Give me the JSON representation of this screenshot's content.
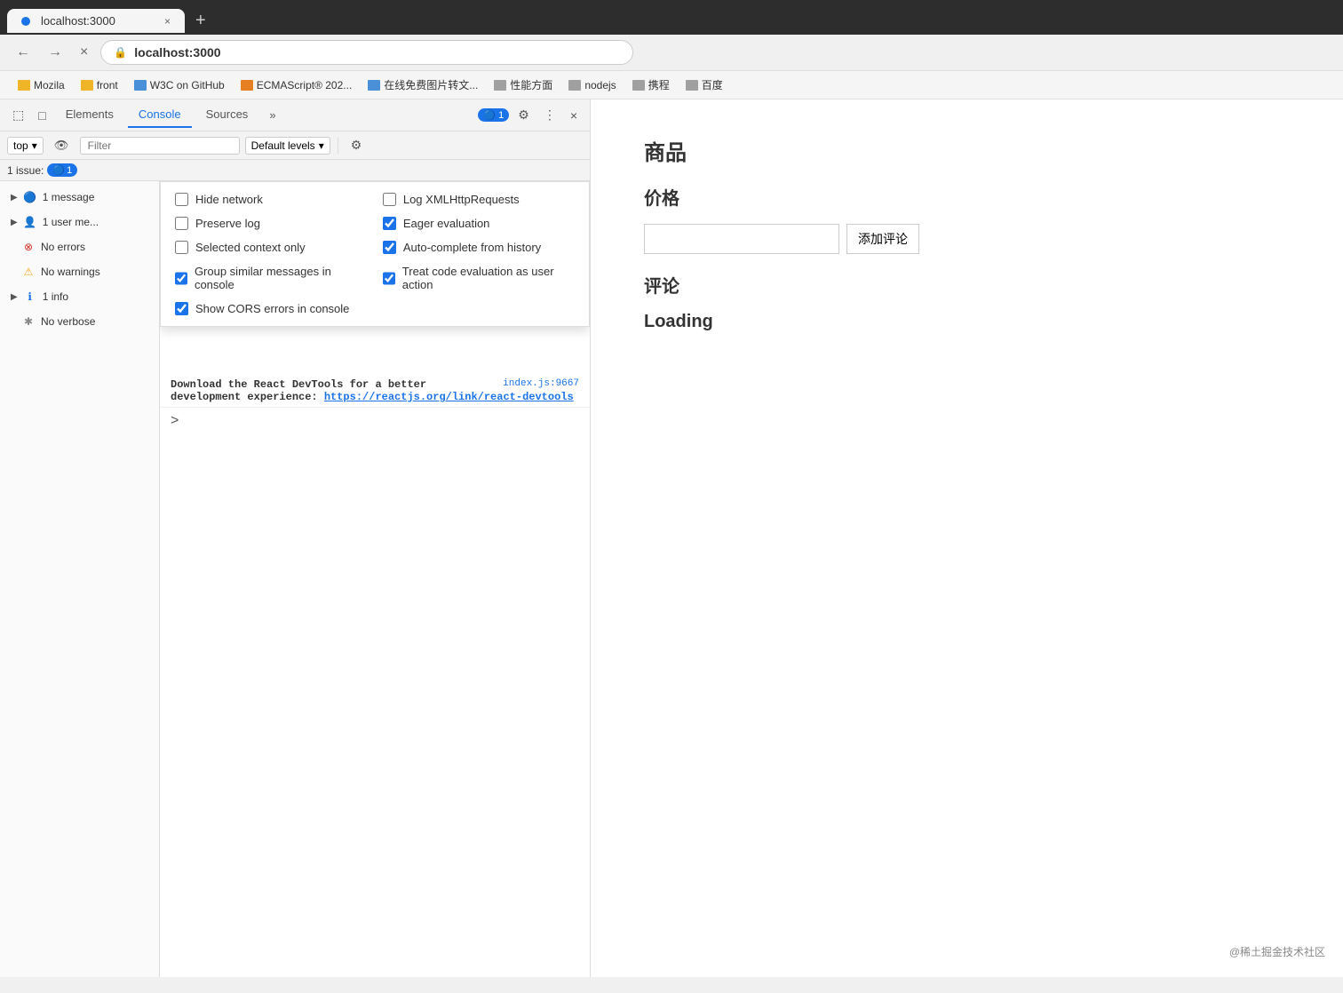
{
  "browser": {
    "tab_title": "localhost:3000",
    "close_tab": "×",
    "new_tab": "+",
    "back_btn": "←",
    "forward_btn": "→",
    "reload_btn": "×",
    "address": "localhost:",
    "address_bold": "3000",
    "bookmarks": [
      {
        "label": "Mozila",
        "type": "folder"
      },
      {
        "label": "front",
        "type": "folder"
      },
      {
        "label": "W3C on GitHub",
        "type": "folder-blue"
      },
      {
        "label": "ECMAScript® 202...",
        "type": "folder-orange"
      },
      {
        "label": "在线免费图片转文...",
        "type": "folder-blue"
      },
      {
        "label": "性能方面",
        "type": "folder"
      },
      {
        "label": "nodejs",
        "type": "folder"
      },
      {
        "label": "携程",
        "type": "folder"
      },
      {
        "label": "百度",
        "type": "folder"
      }
    ]
  },
  "devtools": {
    "tabs": [
      "Elements",
      "Console",
      "Sources"
    ],
    "active_tab": "Console",
    "more_tabs": "»",
    "issue_count": "1",
    "issue_icon": "🔵",
    "settings_icon": "⚙",
    "more_icon": "⋮",
    "close_icon": "×",
    "inspect_icon": "⬚",
    "device_icon": "□",
    "console_toolbar": {
      "context": "top",
      "context_arrow": "▾",
      "filter_placeholder": "Filter",
      "level": "Default levels",
      "level_arrow": "▾",
      "gear_icon": "⚙"
    },
    "issues_bar": {
      "text": "1 issue:",
      "badge_icon": "🔵",
      "badge_count": "1"
    },
    "sidebar": [
      {
        "label": "1 message",
        "icon": "message",
        "arrow": "▶"
      },
      {
        "label": "1 user me...",
        "icon": "user",
        "arrow": "▶"
      },
      {
        "label": "No errors",
        "icon": "error"
      },
      {
        "label": "No warnings",
        "icon": "warning"
      },
      {
        "label": "1 info",
        "icon": "info",
        "arrow": "▶"
      },
      {
        "label": "No verbose",
        "icon": "verbose"
      }
    ],
    "dropdown": {
      "col1": [
        {
          "label": "Hide network",
          "checked": false
        },
        {
          "label": "Preserve log",
          "checked": false
        },
        {
          "label": "Selected context only",
          "checked": false
        },
        {
          "label": "Group similar messages in console",
          "checked": true
        },
        {
          "label": "Show CORS errors in console",
          "checked": true
        }
      ],
      "col2": [
        {
          "label": "Log XMLHttpRequests",
          "checked": false
        },
        {
          "label": "Eager evaluation",
          "checked": true
        },
        {
          "label": "Auto-complete from history",
          "checked": true
        },
        {
          "label": "Treat code evaluation as user action",
          "checked": true
        }
      ]
    },
    "log_source": "index.js:9667",
    "log_text": "Download the React DevTools for a better development experience: ",
    "log_link_text": "https://reactjs.org/link/react-devtools",
    "log_link": "https://reactjs.org/link/react-devtools",
    "prompt_symbol": ">"
  },
  "webpage": {
    "product_label": "商品",
    "price_label": "价格",
    "comment_placeholder": "",
    "add_comment_btn": "添加评论",
    "comment_label": "评论",
    "loading_text": "Loading",
    "footer": "@稀土掘金技术社区"
  }
}
